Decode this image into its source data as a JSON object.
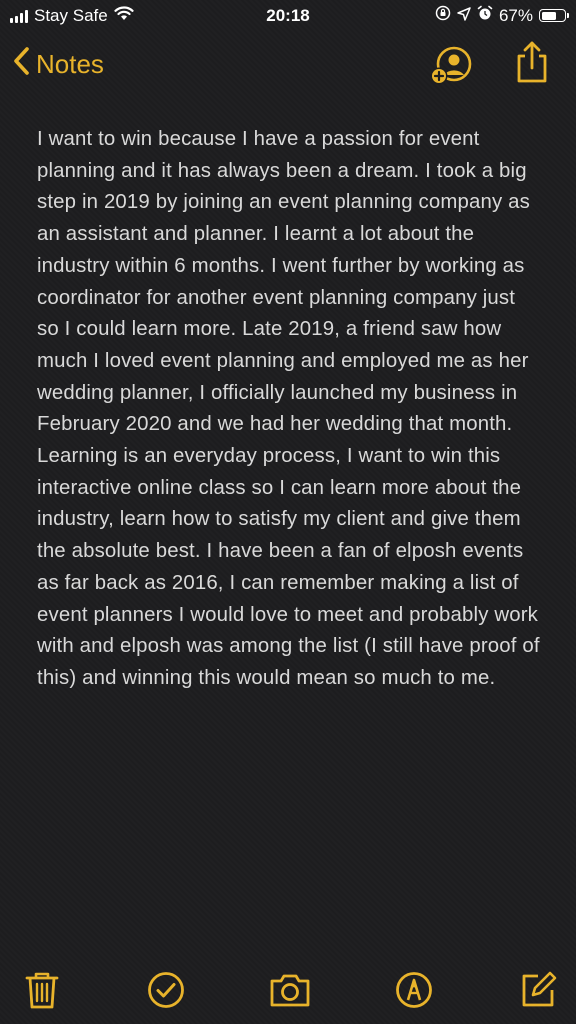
{
  "status_bar": {
    "carrier": "Stay Safe",
    "time": "20:18",
    "battery_percent": "67%",
    "battery_level": 0.67,
    "icons": [
      "signal-icon",
      "wifi-icon",
      "orientation-lock-icon",
      "location-arrow-icon",
      "alarm-icon",
      "battery-icon"
    ]
  },
  "nav": {
    "back_label": "Notes",
    "accent_color": "#e8b32b",
    "icons": [
      "chevron-left-icon",
      "add-people-icon",
      "share-icon"
    ]
  },
  "note": {
    "paragraphs": [
      "I want to win because I have a passion for event planning and it has always been a dream. I took a big step in 2019 by joining an event planning company as an assistant and planner. I learnt a lot about the industry within 6 months. I went further by working as coordinator for another event planning company just so I could learn more. Late 2019, a friend saw how much I loved event planning and employed me as her wedding planner, I officially launched my business in February 2020 and we had her wedding that month.",
      "Learning is an everyday process, I want to win this interactive online class so I can learn more about the industry, learn how to satisfy my client and give them the absolute best. I have been a fan of elposh events as far back as 2016, I can remember making a list of event planners I would love to meet and probably work with and elposh was among the list (I still have proof of this) and winning this would mean so much to me."
    ]
  },
  "toolbar": {
    "icons": [
      "trash-icon",
      "checklist-icon",
      "camera-icon",
      "markup-pen-icon",
      "compose-icon"
    ]
  }
}
